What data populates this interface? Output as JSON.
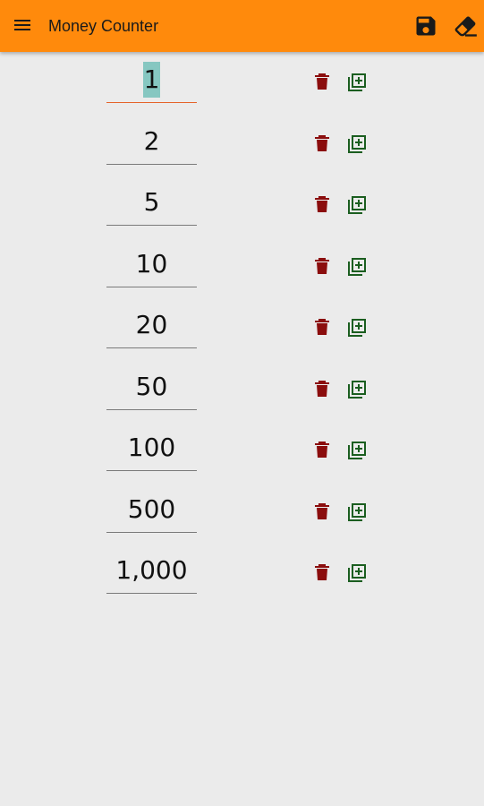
{
  "app": {
    "title": "Money Counter",
    "menu_icon": "menu-icon",
    "save_icon": "save-icon",
    "clear_icon": "eraser-icon",
    "accent_color": "#ff8a0c"
  },
  "denominations": [
    {
      "value": "1",
      "focused": true
    },
    {
      "value": "2",
      "focused": false
    },
    {
      "value": "5",
      "focused": false
    },
    {
      "value": "10",
      "focused": false
    },
    {
      "value": "20",
      "focused": false
    },
    {
      "value": "50",
      "focused": false
    },
    {
      "value": "100",
      "focused": false
    },
    {
      "value": "500",
      "focused": false
    },
    {
      "value": "1,000",
      "focused": false
    }
  ],
  "row_actions": {
    "delete_icon": "trash-icon",
    "delete_color": "#8b0d0d",
    "add_icon": "add-copy-icon",
    "add_color": "#1b5e20"
  }
}
